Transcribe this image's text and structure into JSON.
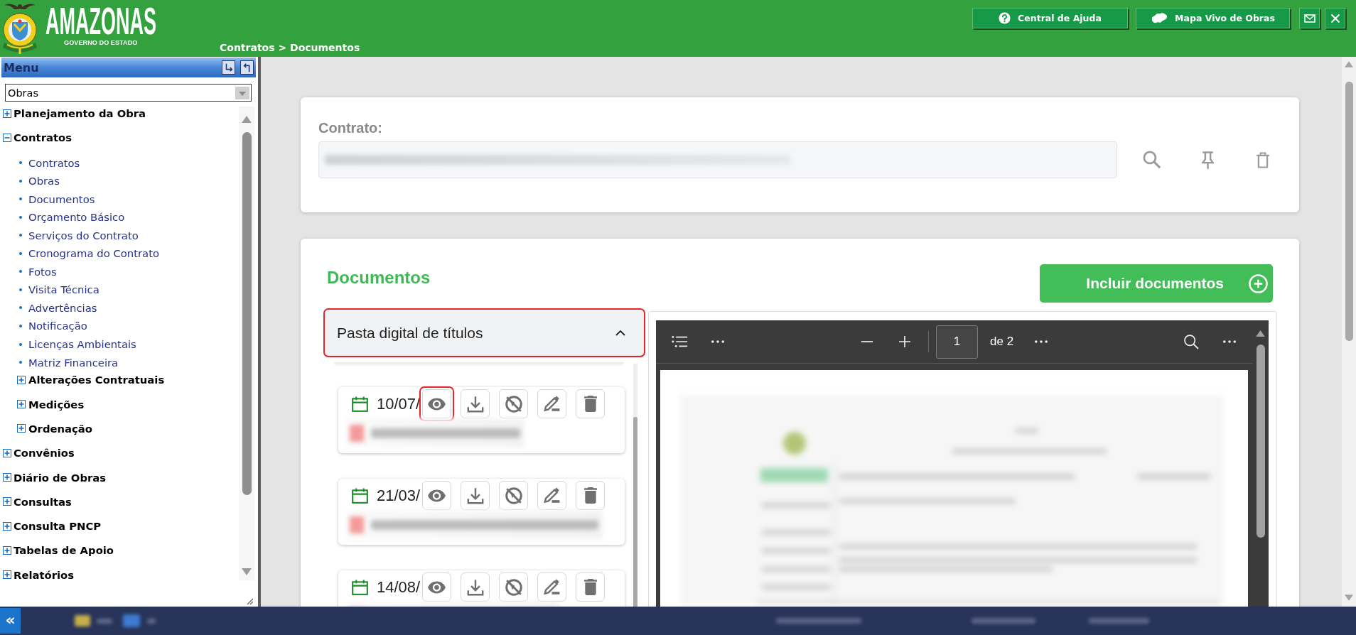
{
  "header": {
    "logo": {
      "title": "AMAZONAS",
      "subtitle": "GOVERNO DO ESTADO"
    },
    "breadcrumb": "Contratos > Documentos",
    "buttons": [
      {
        "kind": "help",
        "label": "Central de Ajuda"
      },
      {
        "kind": "map",
        "label": "Mapa Vivo de Obras"
      },
      {
        "kind": "mail"
      },
      {
        "kind": "close"
      }
    ]
  },
  "sidebar": {
    "title": "Menu",
    "module": "Obras",
    "tree": [
      {
        "label": "Planejamento da Obra",
        "kind": "folder",
        "expanded": false
      },
      {
        "label": "Contratos",
        "kind": "folder",
        "expanded": true,
        "children": [
          {
            "label": "Contratos",
            "kind": "link"
          },
          {
            "label": "Obras",
            "kind": "link"
          },
          {
            "label": "Documentos",
            "kind": "link"
          },
          {
            "label": "Orçamento Básico",
            "kind": "link"
          },
          {
            "label": "Serviços do Contrato",
            "kind": "link"
          },
          {
            "label": "Cronograma do Contrato",
            "kind": "link"
          },
          {
            "label": "Fotos",
            "kind": "link"
          },
          {
            "label": "Visita Técnica",
            "kind": "link"
          },
          {
            "label": "Advertências",
            "kind": "link"
          },
          {
            "label": "Notificação",
            "kind": "link"
          },
          {
            "label": "Licenças Ambientais",
            "kind": "link"
          },
          {
            "label": "Matriz Financeira",
            "kind": "link"
          },
          {
            "label": "Alterações Contratuais",
            "kind": "folder",
            "expanded": false
          },
          {
            "label": "Medições",
            "kind": "folder",
            "expanded": false
          },
          {
            "label": "Ordenação",
            "kind": "folder",
            "expanded": false
          }
        ]
      },
      {
        "label": "Convênios",
        "kind": "folder",
        "expanded": false
      },
      {
        "label": "Diário de Obras",
        "kind": "folder",
        "expanded": false
      },
      {
        "label": "Consultas",
        "kind": "folder",
        "expanded": false
      },
      {
        "label": "Consulta PNCP",
        "kind": "folder",
        "expanded": false
      },
      {
        "label": "Tabelas de Apoio",
        "kind": "folder",
        "expanded": false
      },
      {
        "label": "Relatórios",
        "kind": "folder",
        "expanded": false
      }
    ]
  },
  "contract": {
    "label": "Contrato:"
  },
  "documents": {
    "title": "Documentos",
    "add_button": "Incluir documentos",
    "folder": {
      "title": "Pasta digital de títulos",
      "expanded": true,
      "highlighted": true
    },
    "items": [
      {
        "date": "10/07/",
        "actions": [
          {
            "kind": "view",
            "highlighted": true
          },
          {
            "kind": "download",
            "highlighted": false
          },
          {
            "kind": "block",
            "highlighted": false
          },
          {
            "kind": "edit",
            "highlighted": false
          },
          {
            "kind": "delete",
            "highlighted": false
          }
        ]
      },
      {
        "date": "21/03/",
        "actions": [
          {
            "kind": "view",
            "highlighted": false
          },
          {
            "kind": "download",
            "highlighted": false
          },
          {
            "kind": "block",
            "highlighted": false
          },
          {
            "kind": "edit",
            "highlighted": false
          },
          {
            "kind": "delete",
            "highlighted": false
          }
        ]
      },
      {
        "date": "14/08/",
        "actions": [
          {
            "kind": "view",
            "highlighted": false
          },
          {
            "kind": "download",
            "highlighted": false
          },
          {
            "kind": "block",
            "highlighted": false
          },
          {
            "kind": "edit",
            "highlighted": false
          },
          {
            "kind": "delete",
            "highlighted": false
          }
        ]
      }
    ]
  },
  "viewer": {
    "page": "1",
    "page_count": "de 2"
  },
  "status_bar": {
    "collapse_button": "«"
  }
}
